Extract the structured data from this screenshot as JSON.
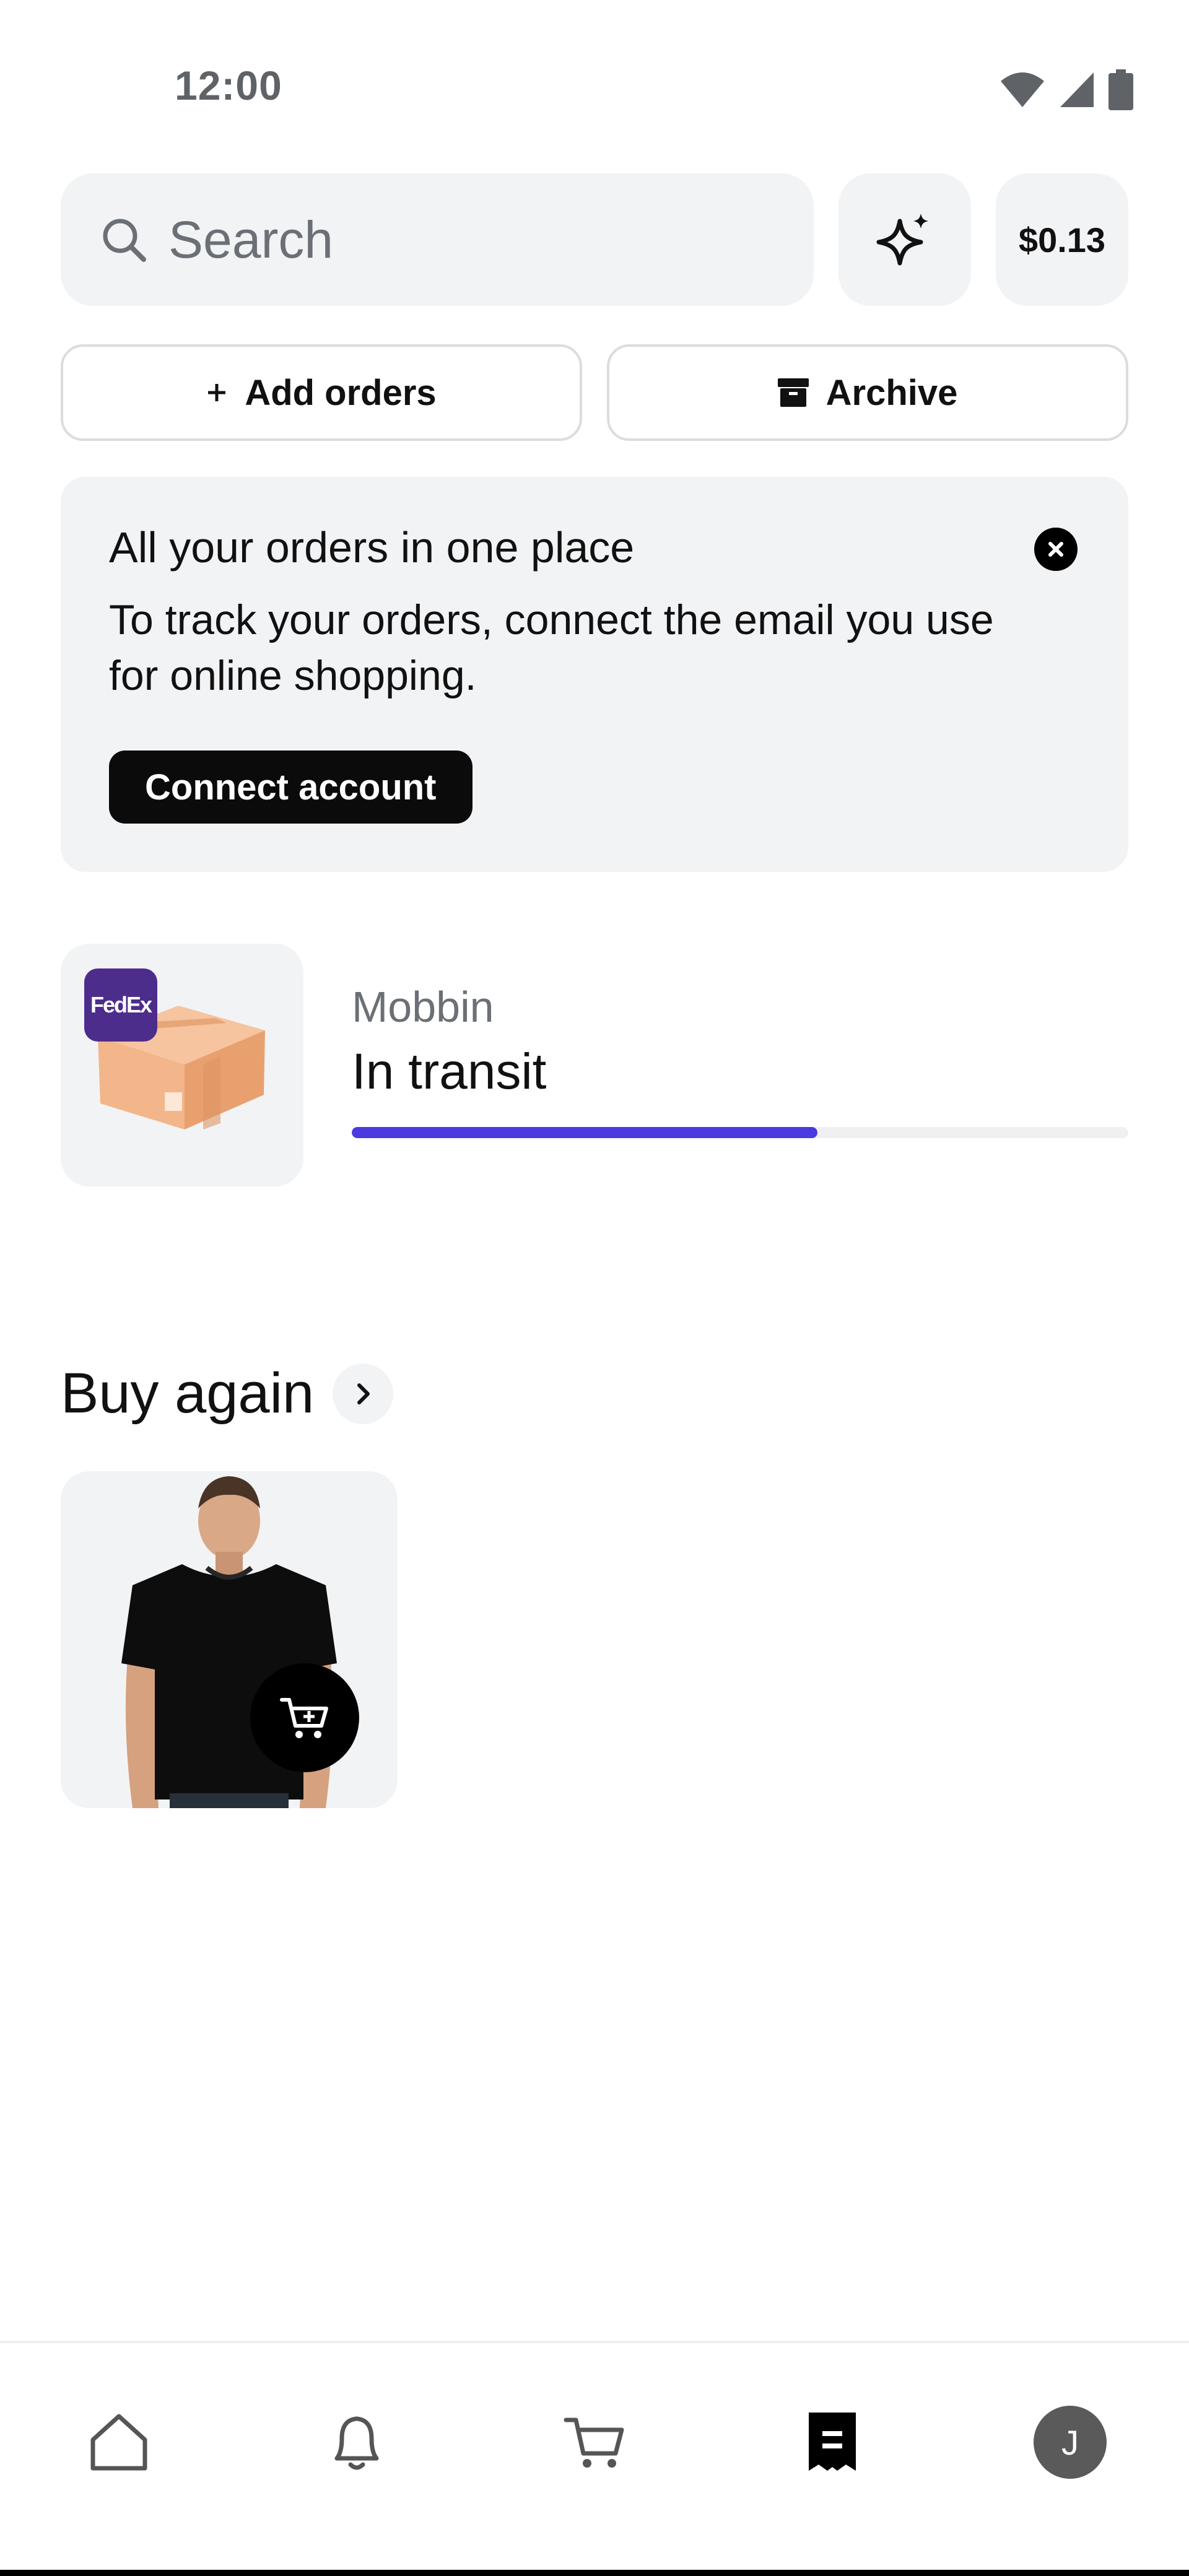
{
  "status_bar": {
    "time": "12:00",
    "icons": [
      "wifi-icon",
      "cellular-icon",
      "battery-icon"
    ]
  },
  "search": {
    "placeholder": "Search"
  },
  "header": {
    "ai_button_icon": "sparkle-icon",
    "balance": "$0.13"
  },
  "actions": {
    "add_orders_label": "Add orders",
    "archive_label": "Archive"
  },
  "banner": {
    "title": "All your orders in one place",
    "body": "To track your orders, connect the email you use for online shopping.",
    "connect_label": "Connect account"
  },
  "order": {
    "carrier_badge": "FedEx",
    "merchant": "Mobbin",
    "status": "In transit",
    "progress": 0.6
  },
  "buy_again": {
    "title": "Buy again"
  },
  "bottom_nav": {
    "items": [
      "home-icon",
      "bell-icon",
      "cart-icon",
      "orders-icon",
      "profile-avatar"
    ],
    "avatar_initial": "J",
    "active": "orders-icon"
  },
  "colors": {
    "accent": "#4a3ae0",
    "surface": "#f2f3f5",
    "fedex": "#4d2d8c"
  }
}
